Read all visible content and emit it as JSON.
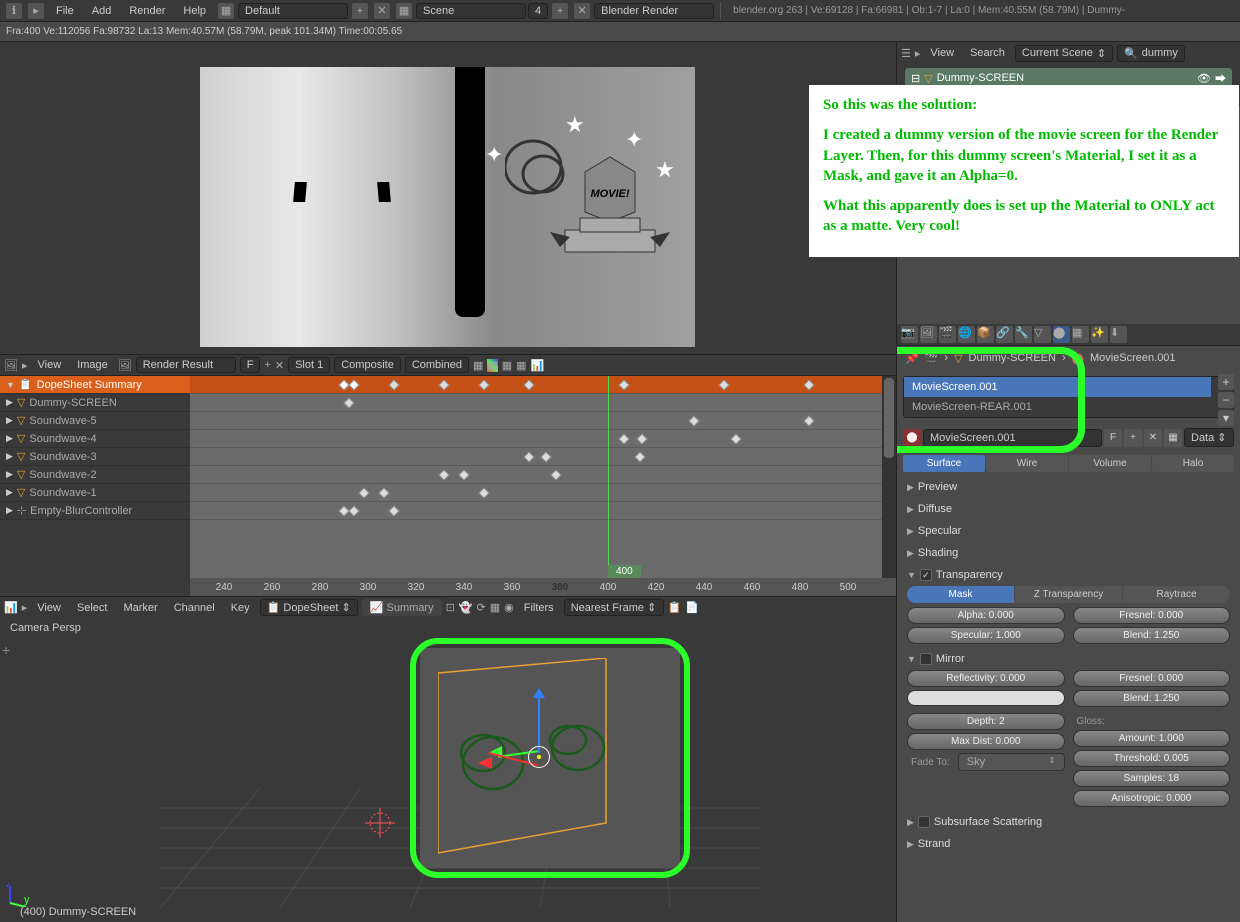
{
  "top": {
    "menu": [
      "File",
      "Add",
      "Render",
      "Help"
    ],
    "layout": "Default",
    "scene": "Scene",
    "scene_idx": "4",
    "engine": "Blender Render",
    "stats": "blender.org 263 | Ve:69128 | Fa:66981 | Ob:1-7 | La:0 | Mem:40.55M (58.79M) | Dummy-"
  },
  "status": "Fra:400  Ve:112056 Fa:98732 La:13 Mem:40.57M (58.79M, peak 101.34M) Time:00:05.65",
  "img_header": {
    "view": "View",
    "image": "Image",
    "result": "Render Result",
    "f": "F",
    "slot": "Slot 1",
    "composite": "Composite",
    "combined": "Combined"
  },
  "dopesheet": {
    "summary": "DopeSheet Summary",
    "items": [
      "Dummy-SCREEN",
      "Soundwave-5",
      "Soundwave-4",
      "Soundwave-3",
      "Soundwave-2",
      "Soundwave-1",
      "Empty-BlurController"
    ],
    "frame": "400",
    "ticks": [
      "240",
      "260",
      "280",
      "300",
      "320",
      "340",
      "360",
      "380",
      "400",
      "420",
      "440",
      "460",
      "480",
      "500"
    ]
  },
  "dope_footer": {
    "menus": [
      "View",
      "Select",
      "Marker",
      "Channel",
      "Key"
    ],
    "mode": "DopeSheet",
    "summary": "Summary",
    "filters": "Filters",
    "nearest": "Nearest Frame"
  },
  "viewport": {
    "label": "Camera Persp",
    "footer": "(400) Dummy-SCREEN"
  },
  "outliner": {
    "view": "View",
    "search": "Search",
    "scene_sel": "Current Scene",
    "filter": "dummy",
    "item": "Dummy-SCREEN"
  },
  "annotation": {
    "p1": "So this was the solution:",
    "p2": "I created a dummy version of the movie screen for the Render Layer.  Then, for this dummy screen's Material, I set it as a Mask, and gave it an Alpha=0.",
    "p3": "What this apparently does is set up the Material to ONLY act as a matte.  Very cool!"
  },
  "props": {
    "breadcrumb_obj": "Dummy-SCREEN",
    "breadcrumb_mat": "MovieScreen.001",
    "mat_list": [
      "MovieScreen.001",
      "MovieScreen-REAR.001"
    ],
    "mat_name": "MovieScreen.001",
    "mat_f": "F",
    "data_mode": "Data",
    "type_tabs": [
      "Surface",
      "Wire",
      "Volume",
      "Halo"
    ],
    "panels": {
      "preview": "Preview",
      "diffuse": "Diffuse",
      "specular": "Specular",
      "shading": "Shading",
      "transparency": "Transparency",
      "mirror": "Mirror",
      "sss": "Subsurface Scattering",
      "strand": "Strand"
    },
    "trans": {
      "modes": [
        "Mask",
        "Z Transparency",
        "Raytrace"
      ],
      "alpha": "Alpha: 0.000",
      "specular": "Specular: 1.000",
      "fresnel": "Fresnel: 0.000",
      "blend": "Blend: 1.250"
    },
    "mirror": {
      "reflect": "Reflectivity: 0.000",
      "fresnel": "Fresnel: 0.000",
      "blend": "Blend: 1.250",
      "depth": "Depth: 2",
      "maxdist": "Max Dist: 0.000",
      "fadeto": "Fade To:",
      "sky": "Sky",
      "gloss": "Gloss:",
      "amount": "Amount: 1.000",
      "threshold": "Threshold: 0.005",
      "samples": "Samples: 18",
      "aniso": "Anisotropic: 0.000"
    }
  }
}
